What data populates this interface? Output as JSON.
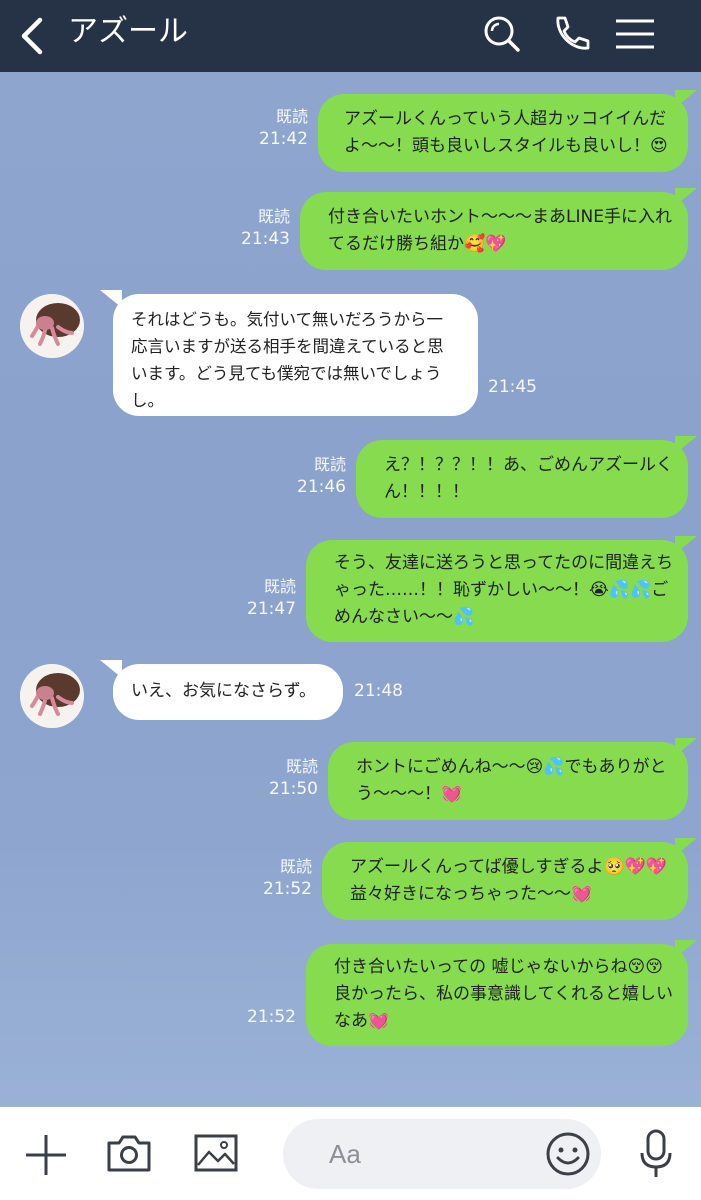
{
  "header": {
    "title": "アズール",
    "colors": {
      "bg": "#263245",
      "icon": "#ffffff"
    },
    "icons": [
      "back-chevron-icon",
      "search-icon",
      "phone-icon",
      "menu-icon"
    ]
  },
  "messages": [
    {
      "from": "me",
      "lines": [
        "アズールくんっていう人超カッコイイんだ",
        "よ〜〜！頭も良いしスタイルも良いし！😍"
      ],
      "read": "既読",
      "time": "21:42"
    },
    {
      "from": "me",
      "lines": [
        "付き合いたいホント〜〜〜まあLINE手に入れ",
        "てるだけ勝ち組か🥰💖"
      ],
      "read": "既読",
      "time": "21:43"
    },
    {
      "from": "them",
      "lines": [
        "それはどうも。気付いて無いだろうから一",
        "応言いますが送る相手を間違えていると思",
        "います。どう見ても僕宛では無いでしょう",
        "し。"
      ],
      "time": "21:45"
    },
    {
      "from": "me",
      "lines": [
        "え？！？？！！あ、ごめんアズールく",
        "ん！！！！"
      ],
      "read": "既読",
      "time": "21:46"
    },
    {
      "from": "me",
      "lines": [
        "そう、友達に送ろうと思ってたのに間違えち",
        "ゃった……！！恥ずかしい〜〜！😭💦💦ご",
        "めんなさい〜〜💦"
      ],
      "read": "既読",
      "time": "21:47"
    },
    {
      "from": "them",
      "lines": [
        "いえ、お気になさらず。"
      ],
      "time": "21:48"
    },
    {
      "from": "me",
      "lines": [
        "ホントにごめんね〜〜😢💦でもありがと",
        "う〜〜〜！💓"
      ],
      "read": "既読",
      "time": "21:50"
    },
    {
      "from": "me",
      "lines": [
        "アズールくんってば優しすぎるよ🥺💖💖",
        "益々好きになっちゃった〜〜💓"
      ],
      "read": "既読",
      "time": "21:52"
    },
    {
      "from": "me",
      "lines": [
        "付き合いたいっての 嘘じゃないからね😚😚",
        "良かったら、私の事意識してくれると嬉しい",
        "なあ💓"
      ],
      "read": "",
      "time": "21:52"
    }
  ],
  "input": {
    "placeholder": "Aa"
  },
  "toolbar": {
    "icons": [
      "plus-icon",
      "camera-icon",
      "image-icon",
      "emoji-icon",
      "microphone-icon"
    ]
  },
  "colors": {
    "outgoing_bubble": "#86db4e",
    "incoming_bubble": "#ffffff",
    "chat_bg": "#8ea6cf"
  }
}
